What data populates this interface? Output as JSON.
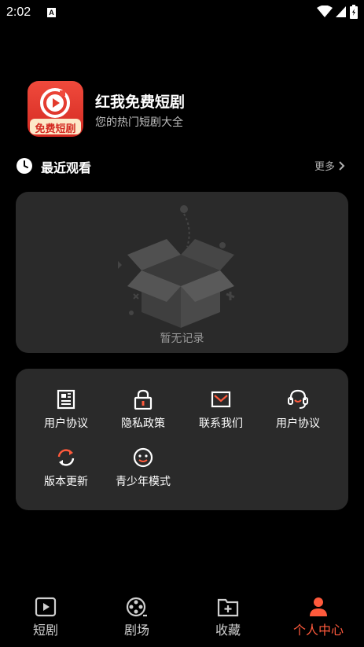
{
  "status_bar": {
    "time": "2:02",
    "notif_letter": "A"
  },
  "app": {
    "name": "红我免费短剧",
    "slogan": "您的热门短剧大全",
    "logo_text": "免费短剧",
    "accent_color": "#ff5a3c"
  },
  "recent": {
    "title": "最近观看",
    "more_label": "更多",
    "empty_text": "暂无记录"
  },
  "tools": [
    {
      "label": "用户协议",
      "icon": "document-icon"
    },
    {
      "label": "隐私政策",
      "icon": "lock-icon"
    },
    {
      "label": "联系我们",
      "icon": "mail-icon"
    },
    {
      "label": "用户协议",
      "icon": "headset-icon"
    },
    {
      "label": "版本更新",
      "icon": "refresh-icon"
    },
    {
      "label": "青少年模式",
      "icon": "smile-icon"
    }
  ],
  "nav": {
    "items": [
      {
        "label": "短剧",
        "icon": "play-icon"
      },
      {
        "label": "剧场",
        "icon": "film-reel-icon"
      },
      {
        "label": "收藏",
        "icon": "folder-add-icon"
      },
      {
        "label": "个人中心",
        "icon": "person-icon"
      }
    ],
    "active_index": 3
  }
}
